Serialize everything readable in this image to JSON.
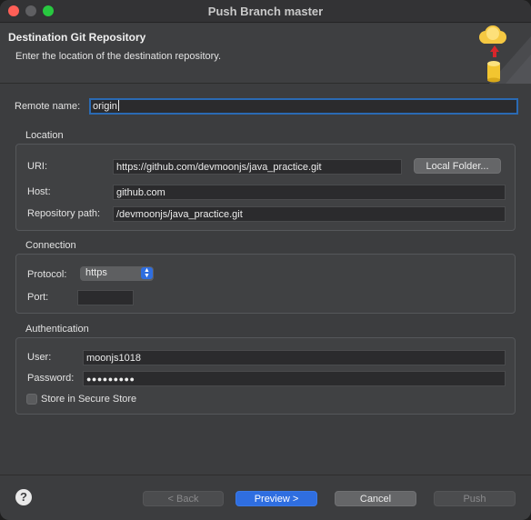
{
  "window": {
    "title": "Push Branch master"
  },
  "banner": {
    "title": "Destination Git Repository",
    "description": "Enter the location of the destination repository."
  },
  "remote": {
    "label": "Remote name:",
    "value": "origin"
  },
  "location": {
    "group_label": "Location",
    "uri_label": "URI:",
    "uri_value": "https://github.com/devmoonjs/java_practice.git",
    "local_folder_button": "Local Folder...",
    "host_label": "Host:",
    "host_value": "github.com",
    "repo_path_label": "Repository path:",
    "repo_path_value": "/devmoonjs/java_practice.git"
  },
  "connection": {
    "group_label": "Connection",
    "protocol_label": "Protocol:",
    "protocol_value": "https",
    "port_label": "Port:",
    "port_value": ""
  },
  "authentication": {
    "group_label": "Authentication",
    "user_label": "User:",
    "user_value": "moonjs1018",
    "password_label": "Password:",
    "password_value": "●●●●●●●●●",
    "store_label": "Store in Secure Store",
    "store_checked": false
  },
  "footer": {
    "help": "?",
    "back_button": "< Back",
    "preview_button": "Preview >",
    "cancel_button": "Cancel",
    "push_button": "Push"
  },
  "colors": {
    "accent": "#2f6ee0",
    "focus_ring": "#2a6ab3",
    "window_bg": "#3c3d3f"
  },
  "icons": [
    "git-push-cloud-icon",
    "help-icon",
    "select-arrows-icon"
  ]
}
